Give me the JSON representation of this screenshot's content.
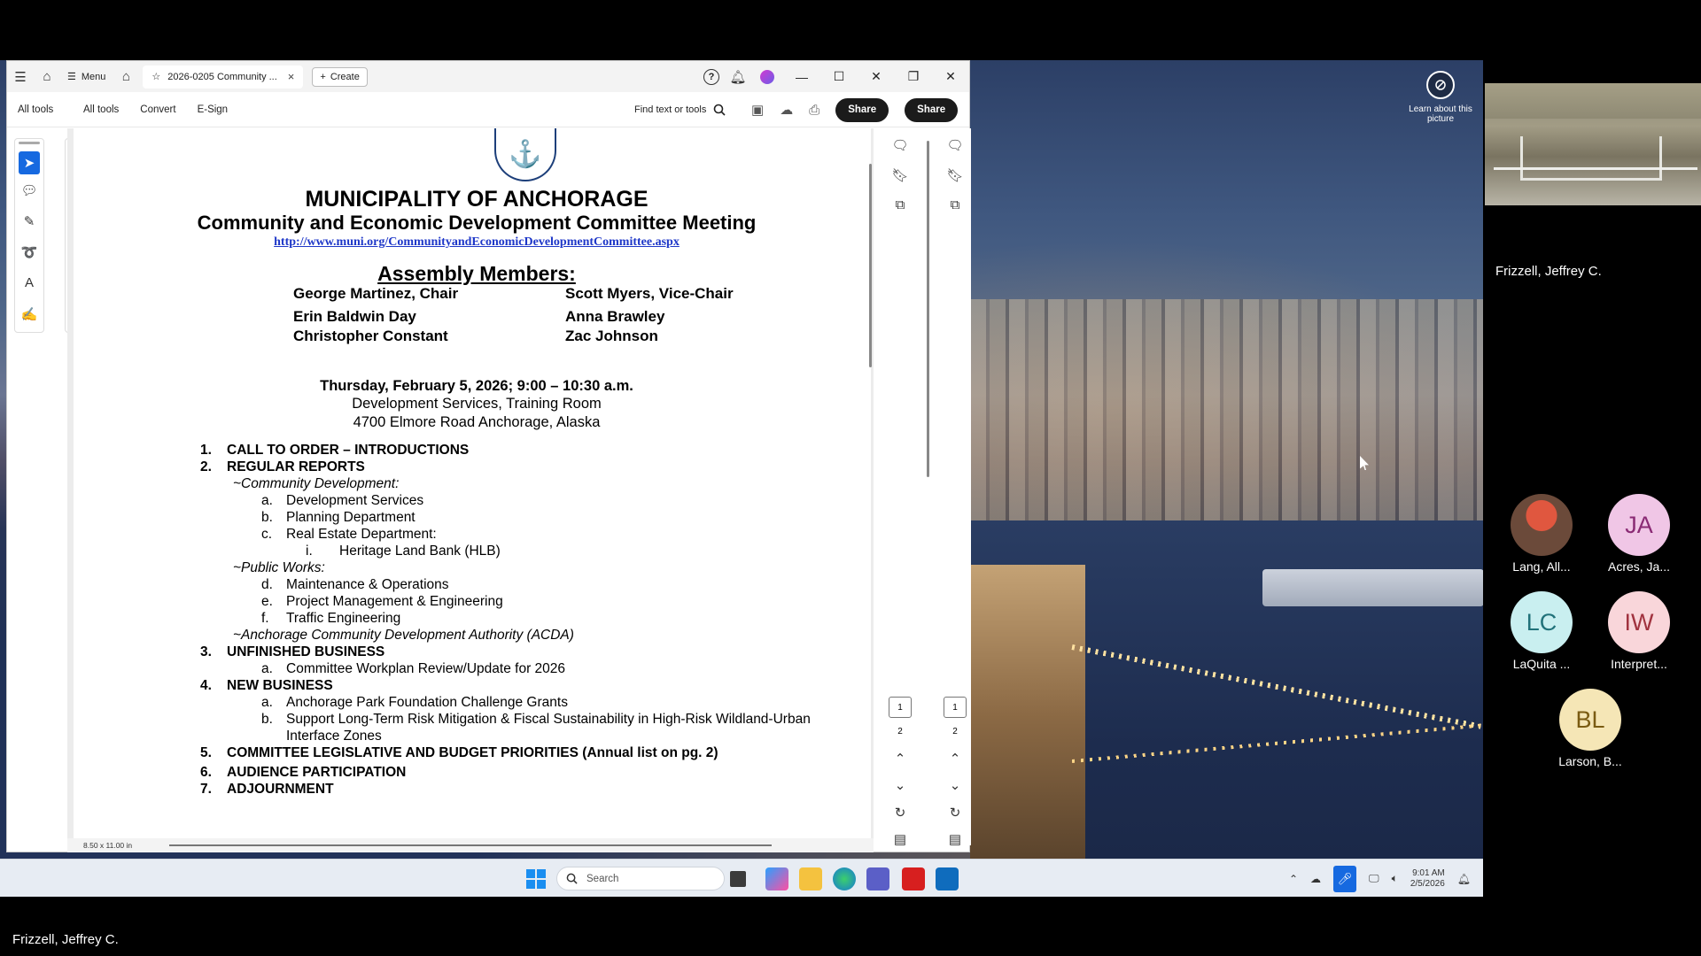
{
  "acrobat": {
    "menu_label": "Menu",
    "tab_title": "2026-0205 Community ...",
    "create_label": "Create",
    "toolbar": {
      "all_tools_left": "All tools",
      "all_tools": "All tools",
      "convert": "Convert",
      "esign": "E-Sign",
      "find_placeholder": "Find text or tools",
      "share": "Share",
      "share2": "Share"
    },
    "page_size": "8.50 x 11.00 in",
    "pages": [
      "1",
      "2"
    ]
  },
  "document": {
    "org": "MUNICIPALITY OF ANCHORAGE",
    "committee": "Community and Economic Development Committee Meeting",
    "url": "http://www.muni.org/CommunityandEconomicDevelopmentCommittee.aspx",
    "assembly_heading": "Assembly Members:",
    "members": [
      "George Martinez, Chair",
      "Scott Myers, Vice-Chair",
      "Erin Baldwin Day",
      "Anna Brawley",
      "Christopher Constant",
      "Zac Johnson"
    ],
    "meeting_date": "Thursday, February 5, 2026; 9:00 – 10:30 a.m.",
    "meeting_location": "Development Services, Training Room",
    "meeting_address": "4700 Elmore Road Anchorage, Alaska",
    "agenda": {
      "n1": "1.",
      "i1": "CALL TO ORDER – INTRODUCTIONS",
      "n2": "2.",
      "i2": "REGULAR REPORTS",
      "h_cd": "~Community Development:",
      "a1": "a.",
      "a1t": "Development Services",
      "b1": "b.",
      "b1t": "Planning Department",
      "c1": "c.",
      "c1t": "Real Estate Department:",
      "i_roman": "i.",
      "i_t": "Heritage Land Bank (HLB)",
      "h_pw": "~Public Works:",
      "d1": "d.",
      "d1t": "Maintenance & Operations",
      "e1": "e.",
      "e1t": "Project Management & Engineering",
      "f1": "f.",
      "f1t": "Traffic Engineering",
      "h_acda": "~Anchorage Community Development Authority (ACDA)",
      "n3": "3.",
      "i3": "UNFINISHED BUSINESS",
      "a3": "a.",
      "a3t": "Committee Workplan Review/Update for 2026",
      "n4": "4.",
      "i4": "NEW BUSINESS",
      "a4": "a.",
      "a4t": "Anchorage Park Foundation Challenge Grants",
      "b4": "b.",
      "b4t": "Support Long-Term Risk Mitigation & Fiscal Sustainability in High-Risk Wildland-Urban",
      "b4t2": "Interface Zones",
      "n5": "5.",
      "i5": "COMMITTEE LEGISLATIVE AND BUDGET PRIORITIES (Annual list on pg. 2)",
      "n6": "6.",
      "i6": "AUDIENCE PARTICIPATION",
      "n7": "7.",
      "i7": "ADJOURNMENT"
    }
  },
  "desktop": {
    "learn_about": "Learn about this picture",
    "search_placeholder": "Search",
    "time": "9:01 AM",
    "date": "2/5/2026"
  },
  "meeting": {
    "presenter": "Frizzell, Jeffrey C.",
    "bottom_name": "Frizzell, Jeffrey C.",
    "participants": [
      {
        "initials": "",
        "name": "Lang, All...",
        "color": "#6b4a3a"
      },
      {
        "initials": "JA",
        "name": "Acres, Ja...",
        "color": "#f0c6e6"
      },
      {
        "initials": "LC",
        "name": "LaQuita ...",
        "color": "#c9eff0"
      },
      {
        "initials": "IW",
        "name": "Interpret...",
        "color": "#f9d6da"
      },
      {
        "initials": "BL",
        "name": "Larson, B...",
        "color": "#f5e6b6"
      }
    ]
  }
}
